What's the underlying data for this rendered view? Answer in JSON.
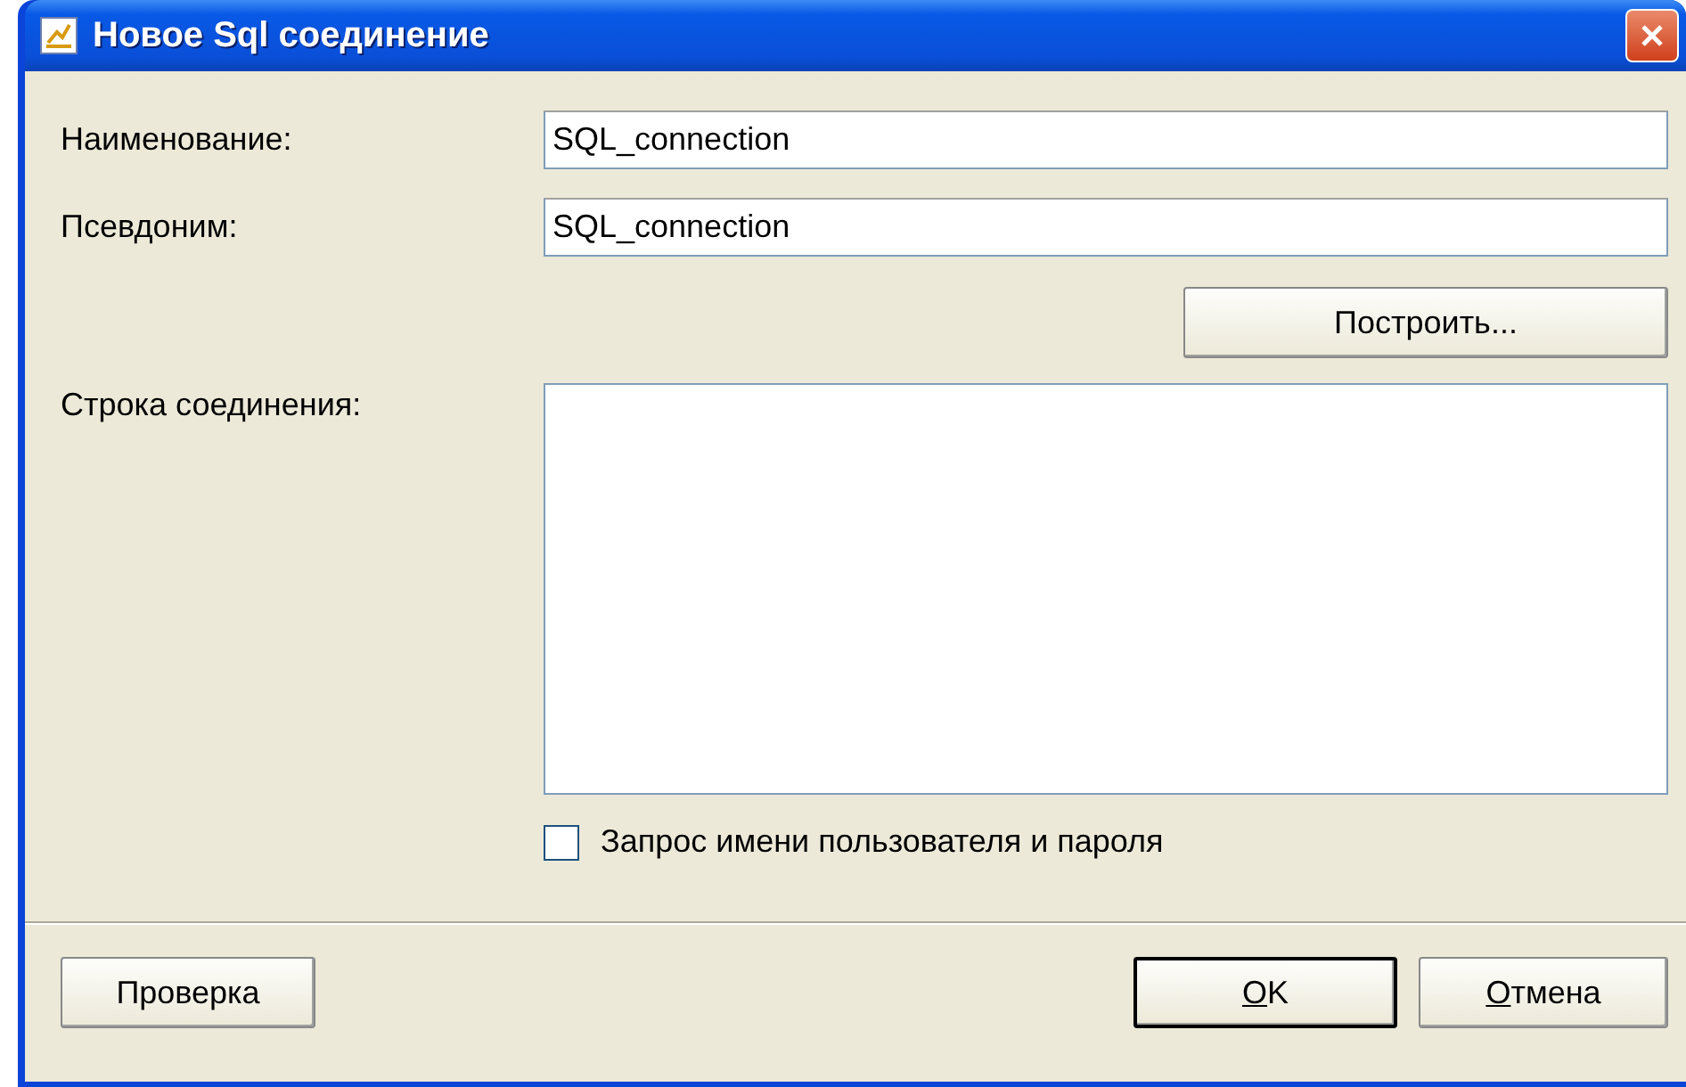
{
  "window": {
    "title": "Новое Sql соединение"
  },
  "fields": [
    {
      "label": "Наименование:",
      "value": "SQL_connection"
    },
    {
      "label": "Псевдоним:",
      "value": "SQL_connection"
    }
  ],
  "build_button": "Построить...",
  "connection_string": {
    "label": "Строка соединения:"
  },
  "prompt_checkbox": {
    "label": "Запрос имени пользователя и пароля",
    "checked": false
  },
  "test_button": "Проверка",
  "ok_button": {
    "mnemonic": "О",
    "rest": "K",
    "default": true
  },
  "cancel_button": {
    "mnemonic": "О",
    "rest": "тмена",
    "default": false
  }
}
